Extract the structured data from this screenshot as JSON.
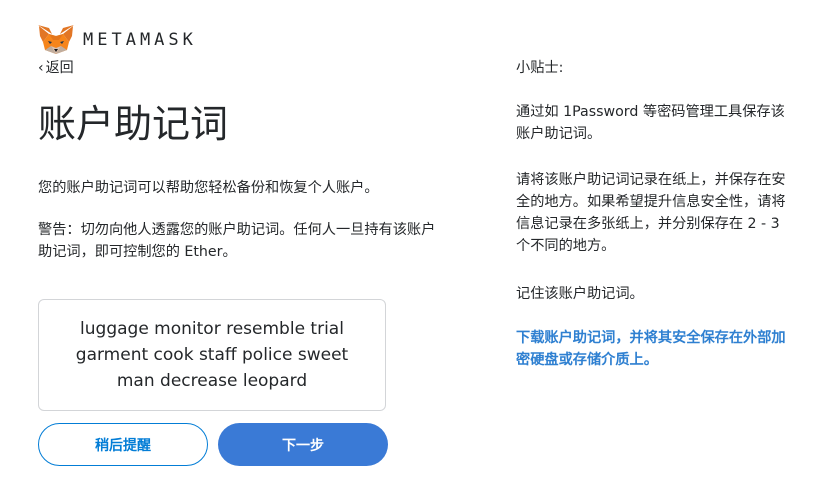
{
  "header": {
    "brand": "METAMASK",
    "logo_icon": "metamask-fox-icon"
  },
  "nav": {
    "back_label": "返回",
    "back_icon": "chevron-left-icon"
  },
  "page": {
    "title": "账户助记词",
    "description": "您的账户助记词可以帮助您轻松备份和恢复个人账户。",
    "warning": "警告：切勿向他人透露您的账户助记词。任何人一旦持有该账户助记词，即可控制您的 Ether。"
  },
  "seed": {
    "phrase": "luggage monitor resemble trial garment cook staff police sweet man decrease leopard"
  },
  "buttons": {
    "remind_later": "稍后提醒",
    "next": "下一步"
  },
  "tips": {
    "title": "小贴士:",
    "tip1": "通过如 1Password 等密码管理工具保存该账户助记词。",
    "tip2": "请将该账户助记词记录在纸上，并保存在安全的地方。如果希望提升信息安全性，请将信息记录在多张纸上，并分别保存在 2 - 3 个不同的地方。",
    "tip3": "记住该账户助记词。",
    "download_link": "下载账户助记词，并将其安全保存在外部加密硬盘或存储介质上。"
  },
  "colors": {
    "accent": "#037dd6",
    "primary_button": "#3a7ad6",
    "link": "#2f80d1",
    "text": "#24272a"
  }
}
